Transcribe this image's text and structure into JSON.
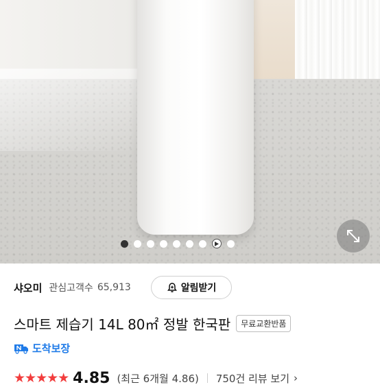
{
  "hero": {
    "image_alt": "",
    "carousel": {
      "total_dots": 9,
      "active_index": 0,
      "video_dot_index": 7
    }
  },
  "brand": {
    "name": "샤오미",
    "followers_label": "관심고객수",
    "followers_count": "65,913",
    "alert_button": "알림받기"
  },
  "product": {
    "title": "스마트 제습기 14L 80㎡ 정발 한국판",
    "badge": "무료교환반품"
  },
  "delivery": {
    "label": "도착보장",
    "color": "#1f7be8"
  },
  "rating": {
    "stars": "★★★★★",
    "stars_value": 5,
    "score": "4.85",
    "recent": "(최근 6개월 4.86)",
    "review_link": "750건 리뷰 보기",
    "chevron": "›",
    "star_color": "#f23d3d"
  }
}
